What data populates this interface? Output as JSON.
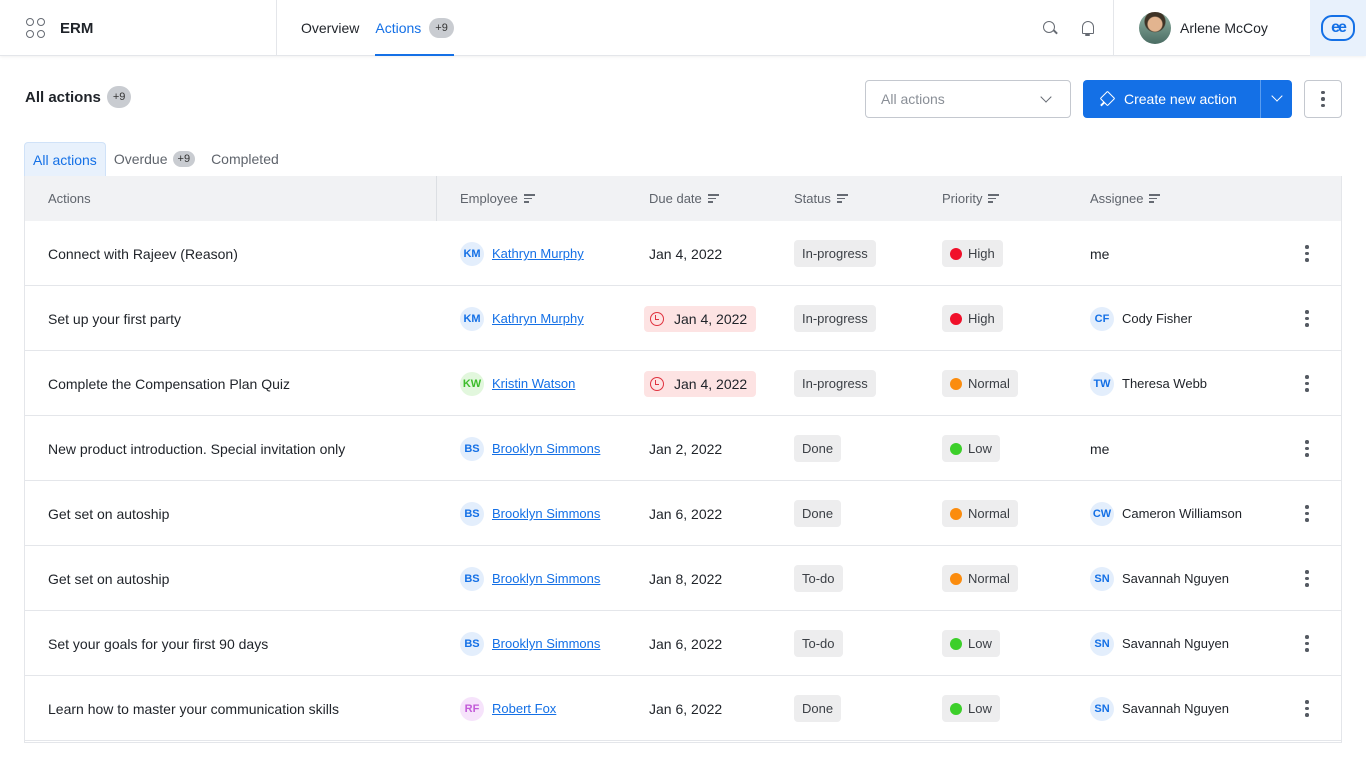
{
  "app": {
    "name": "ERM"
  },
  "nav": {
    "tabs": [
      {
        "label": "Overview"
      },
      {
        "label": "Actions",
        "badge": "+9"
      }
    ]
  },
  "user": {
    "name": "Arlene McCoy",
    "logo": "ee"
  },
  "header": {
    "title": "All actions",
    "badge": "+9",
    "filter_value": "All actions",
    "create_label": "Create new action"
  },
  "subtabs": [
    {
      "label": "All actions"
    },
    {
      "label": "Overdue",
      "badge": "+9"
    },
    {
      "label": "Completed"
    }
  ],
  "columns": {
    "actions": "Actions",
    "employee": "Employee",
    "due": "Due date",
    "status": "Status",
    "priority": "Priority",
    "assignee": "Assignee"
  },
  "priority_colors": {
    "High": "#f0102a",
    "Normal": "#fb8c0e",
    "Low": "#3ccf2a"
  },
  "rows": [
    {
      "action": "Connect with Rajeev (Reason)",
      "emp_initials": "KM",
      "emp_name": "Kathryn Murphy",
      "due": "Jan 4, 2022",
      "overdue": false,
      "status": "In-progress",
      "priority": "High",
      "assignee_initials": "",
      "assignee": "me"
    },
    {
      "action": "Set up your first party",
      "emp_initials": "KM",
      "emp_name": "Kathryn Murphy",
      "due": "Jan 4, 2022",
      "overdue": true,
      "status": "In-progress",
      "priority": "High",
      "assignee_initials": "CF",
      "assignee": "Cody Fisher"
    },
    {
      "action": "Complete the Compensation Plan Quiz",
      "emp_initials": "KW",
      "emp_name": "Kristin Watson",
      "due": "Jan 4, 2022",
      "overdue": true,
      "status": "In-progress",
      "priority": "Normal",
      "assignee_initials": "TW",
      "assignee": "Theresa Webb"
    },
    {
      "action": "New product introduction. Special invitation only",
      "emp_initials": "BS",
      "emp_name": "Brooklyn Simmons",
      "due": "Jan 2, 2022",
      "overdue": false,
      "status": "Done",
      "priority": "Low",
      "assignee_initials": "",
      "assignee": "me"
    },
    {
      "action": "Get set on autoship",
      "emp_initials": "BS",
      "emp_name": "Brooklyn Simmons",
      "due": "Jan 6, 2022",
      "overdue": false,
      "status": "Done",
      "priority": "Normal",
      "assignee_initials": "CW",
      "assignee": "Cameron Williamson"
    },
    {
      "action": "Get set on autoship",
      "emp_initials": "BS",
      "emp_name": "Brooklyn Simmons",
      "due": "Jan 8, 2022",
      "overdue": false,
      "status": "To-do",
      "priority": "Normal",
      "assignee_initials": "SN",
      "assignee": "Savannah Nguyen"
    },
    {
      "action": "Set your goals for your first 90 days",
      "emp_initials": "BS",
      "emp_name": "Brooklyn Simmons",
      "due": "Jan 6, 2022",
      "overdue": false,
      "status": "To-do",
      "priority": "Low",
      "assignee_initials": "SN",
      "assignee": "Savannah Nguyen"
    },
    {
      "action": "Learn how to master your communication skills",
      "emp_initials": "RF",
      "emp_name": "Robert Fox",
      "due": "Jan 6, 2022",
      "overdue": false,
      "status": "Done",
      "priority": "Low",
      "assignee_initials": "SN",
      "assignee": "Savannah Nguyen"
    }
  ]
}
